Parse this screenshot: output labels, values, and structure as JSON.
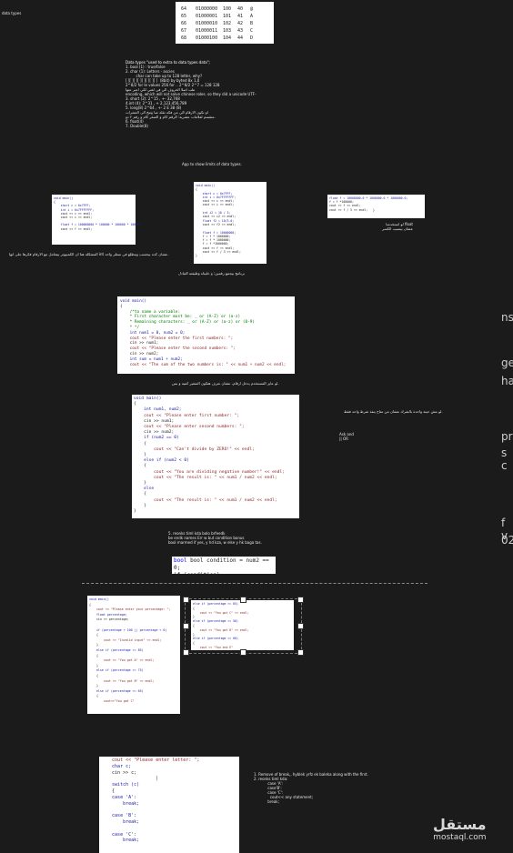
{
  "side_label": "data types",
  "ascii_table": {
    "rows": [
      [
        "64",
        "01000000",
        "100",
        "40",
        "@"
      ],
      [
        "65",
        "01000001",
        "101",
        "41",
        "A"
      ],
      [
        "66",
        "01000010",
        "102",
        "42",
        "B"
      ],
      [
        "67",
        "01000011",
        "103",
        "43",
        "C"
      ],
      [
        "68",
        "01000100",
        "104",
        "44",
        "D"
      ]
    ]
  },
  "datatypes_note": {
    "lines": [
      "Data types \"used to extra to data types data\";",
      "1. bool (1) : true/false",
      "2. char (1): Letters - ascies",
      "         char can take up to 128 letter, why?",
      "[ ][ ][ ][ ][ ][ ][ ][ ]  (8bit) by byted 8x 1,0",
      "2^8/2 for le values 256 for .. 2^8/2 2^7 = 128 128",
      "طب اصلا الحروف الي في لغتي لكي اعبر عنها",
      "encoding, which will not solve chinese roles. so they did a unicode UTF-",
      "3. short (2): 2^15 , +- 32,768",
      "4.int (4): 2^31 , + 2,123,456,789",
      "5. long(8) 2^64 , +- 2 E 38 (8)",
      "او تكون الارقام الي من فكه تقلة صا وتنج الى العشرات",
      "متقسم لعلامات عشرية: الرقم كام و الصغر كام و رقم ٢ دو.",
      "6. float(4)",
      "7. Double(8)"
    ]
  },
  "app_label": "App to show limits of data types.",
  "code_limits": {
    "lines": [
      "void main()",
      "{",
      "    short c = 0x7FFF;",
      "    int i = 0x7FFFFFFF;",
      "    cout << c << endl;",
      "    cout << i << endl;",
      "",
      "    float f = 100000000 * 100000 * 100000 * 10000;",
      "    cout << f << endl;"
    ]
  },
  "code_limits_note": "المشكله هنا ان الكمبيوتر بيتعامل مع الارقام فكرها على انها int عشان كده بيحسب وبتطلع في سطر واحد.",
  "code_center": {
    "lines": [
      "void main()",
      "{",
      "    short c = 0x7FFF;",
      "    int i = 0x7FFFFFFF;",
      "    cout << c << endl;",
      "    cout << i << endl;",
      "",
      "    int i2 = 10 / 3;",
      "    cout << i2 << endl;",
      "    float f2 = 10/3.0;",
      "    cout << f2 << endl;",
      "",
      "    float f = 10000000;",
      "    f = f * 1000000;",
      "    f = f * 1000000;",
      "    f = f *1000000;",
      "    cout << f << endl;",
      "    cout << f / 3 << endl;",
      "}"
    ]
  },
  "center_caption": "برنامج بيجمع رقمين: و خليناه وظيفته التبادل",
  "code_float": {
    "lines": [
      "float f = 10000000.0 * 1000000.0 * 1000000.0;",
      "f = f *100000;",
      "cout << f << endl;",
      "cout << f / 3 << endl;   }"
    ]
  },
  "float_note": "لو استخدمنا float\nعشان بيسيب الكسر",
  "code_sum": {
    "lines": [
      "void main()",
      "{",
      "    /*to name a variable:",
      "    * First character must be: _ or (A-Z) or (a-z)",
      "    * Remaining characters: _ or (A-Z) or (a-z) or (0-9)",
      "    * */",
      "    int num1 = 0, num2 = 0;",
      "    cout << \"Please enter the first numbers: \";",
      "    cin >> num1;",
      "    cout << \"Please enter the second numbers: \";",
      "    cin >> num2;",
      "    int sum = num1 + num2;",
      "    cout << \"The sum of the two numbers is: \" << num1 + num2 << endl;"
    ]
  },
  "sum_caption": "لو عايز المستخدم يدخل ارقام، عشان نعرف هتكون المتغير كمية و بس.",
  "code_divide": {
    "lines": [
      "void main()",
      "{",
      "    int num1, num2;",
      "    cout << \"Please enter first number: \";",
      "    cin >> num1;",
      "    cout << \"Please enter second numbers: \";",
      "    cin >> num2;",
      "    if (num2 == 0)",
      "    {",
      "        cout << \"Can't divide by ZERO!\" << endl;",
      "    }",
      "    else if (num2 < 0)",
      "    {",
      "        cout << \"You are dividing negative number!\" << endl;",
      "        cout << \"The result is: \" << num1 / num2 << endl;",
      "    }",
      "    else",
      "    {",
      "        cout << \"The result is: \" << num1 / num2 << endl;",
      "    }",
      "}"
    ]
  },
  "divide_note_right": "لو مش حيتة واحدة بالشرك عشان من متاح ينفذ شرط واحد فقط.",
  "divide_note_right2": "Ask and\n|| OR",
  "bool_caption": {
    "lines": [
      "5. reonks timl kda bolo brfeedk",
      "be endk names Err w but condition bonus",
      "bool marmed if yes, y hd kza, w else y hk baga tas."
    ]
  },
  "bool_code": {
    "line1": "bool condition = num2 == 0;",
    "line2": "if (condition)"
  },
  "code_percentage": {
    "lines": [
      "void main()",
      "{",
      "    cout << \"Please enter your percentage: \";",
      "    float percentage;",
      "    cin >> percentage;",
      "",
      "    if (percentage > 100 || percentage < 0)",
      "    {",
      "        cout << \"Invalid input\" << endl;",
      "    }",
      "    else if (percentage >= 85)",
      "    {",
      "        cout << \"You got A\" << endl;",
      "    }",
      "    else if (percentage >= 75)",
      "    {",
      "        cout << \"You got B\" << endl;",
      "    }",
      "    else if (percentage >= 65)",
      "    {",
      "        cout<<\"You got C\""
    ]
  },
  "code_percentage2": {
    "lines": [
      "else if (percentage >= 65)",
      "{",
      "    cout << \"You got C\" << endl;",
      "}",
      "else if (percentage >= 50)",
      "{",
      "    cout << \"You got D\" << endl;",
      "}",
      "else if (percentage >= 60)",
      "{",
      "    cout << \"You end E\""
    ]
  },
  "code_switch": {
    "lines": [
      "    cout << \"Please enter letter: \";",
      "    char c;",
      "    cin >> c;",
      "                    |",
      "    switch (c)",
      "    {",
      "    case 'A':",
      "        break;",
      "",
      "    case 'B':",
      "        break;",
      "",
      "    case 'C':",
      "        break;"
    ]
  },
  "switch_note": {
    "lines": [
      "1. Remove of break,, hyblek yrfz ek baleka along with the first.",
      "2. reonks timl kda:",
      "            case 'A':",
      "            case'B':",
      "            case 'C':",
      "              cout<< any statement;",
      "            break;"
    ]
  },
  "right_edge_fragments": [
    "ns",
    "ge",
    "ha",
    "pr",
    "s c",
    "f v",
    "02"
  ],
  "watermark": {
    "logo_text": "مستقل",
    "site": "mostaql.com"
  }
}
